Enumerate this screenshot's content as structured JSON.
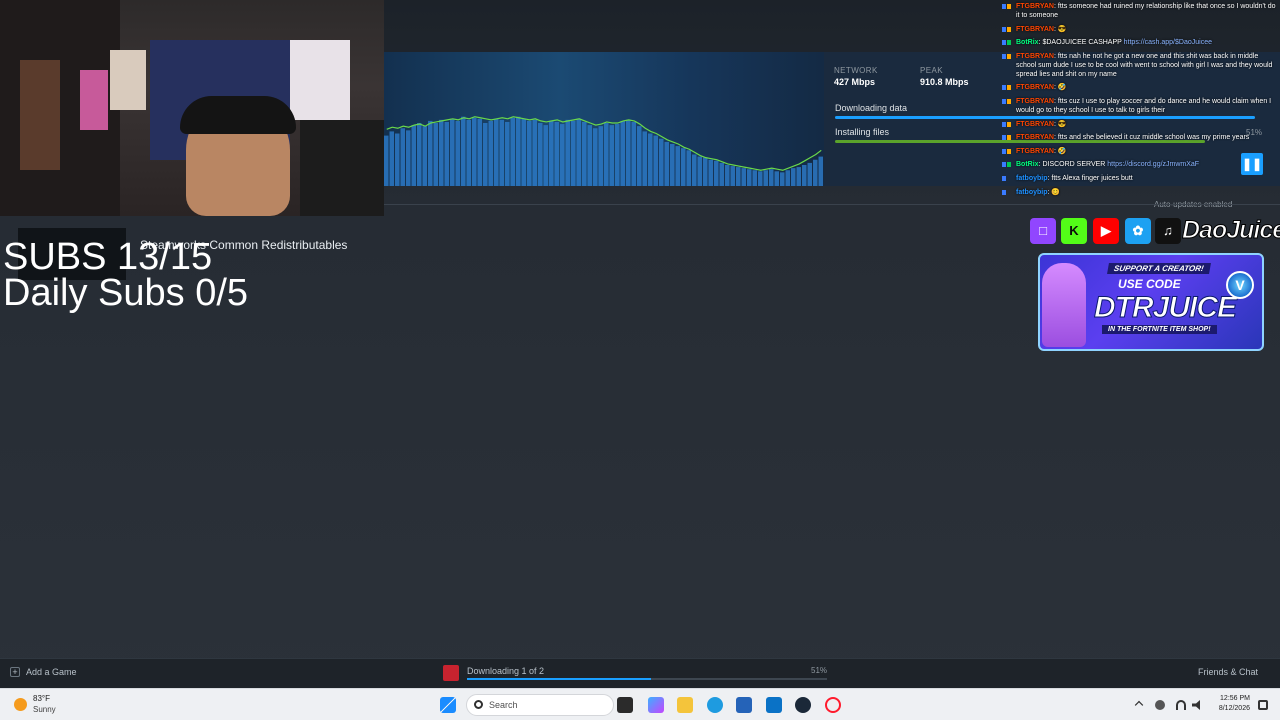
{
  "downloads": {
    "network_label": "NETWORK",
    "network_value": "427 Mbps",
    "peak_label": "PEAK",
    "peak_value": "910.8 Mbps",
    "rows": [
      {
        "label": "Downloading data"
      },
      {
        "label": "Installing files"
      }
    ],
    "percent": "51%",
    "auto_updates": "Auto-updates enabled",
    "queue_item": "Steamworks Common Redistributables"
  },
  "stream_overlay": {
    "subs": "SUBS 13/15",
    "daily": "Daily Subs  0/5",
    "handle": "DaoJuice"
  },
  "chat": [
    {
      "user": "FTGBRYAN",
      "text": ": ftts someone had ruined my relationship like that once so I wouldn't do it to someone",
      "user_color": "#ff4500"
    },
    {
      "user": "FTGBRYAN",
      "text": ": 😎",
      "user_color": "#ff4500"
    },
    {
      "user": "BotRix",
      "text": ": $DAOJUICEE CASHAPP ",
      "link": "https://cash.app/$DaoJuicee",
      "user_color": "#00ff7f"
    },
    {
      "user": "FTGBRYAN",
      "text": ": ftts nah he not he got a new one and this shit was back in middle school sum dude I use to be cool with went to school with girl I was and they would spread lies and shit on my name",
      "user_color": "#ff4500"
    },
    {
      "user": "FTGBRYAN",
      "text": ": 🤣",
      "user_color": "#ff4500"
    },
    {
      "user": "FTGBRYAN",
      "text": ": ftts cuz I use to play soccer and do dance and he would claim when I would go to they school I use to talk to girls their",
      "user_color": "#ff4500"
    },
    {
      "user": "FTGBRYAN",
      "text": ": 😎",
      "user_color": "#ff4500"
    },
    {
      "user": "FTGBRYAN",
      "text": ": ftts and she believed it cuz middle school was my prime years",
      "user_color": "#ff4500"
    },
    {
      "user": "FTGBRYAN",
      "text": ": 🤣",
      "user_color": "#ff4500"
    },
    {
      "user": "BotRix",
      "text": ": DISCORD SERVER ",
      "link": "https://discord.gg/zJmwmXaF",
      "user_color": "#00ff7f"
    },
    {
      "user": "fatboybip",
      "text": ": ftts Alexa finger juices butt",
      "user_color": "#1e90ff"
    },
    {
      "user": "fatboybip",
      "text": ": 😊",
      "user_color": "#1e90ff"
    }
  ],
  "creator_banner": {
    "support": "SUPPORT A CREATOR!",
    "use_code": "USE CODE",
    "code": "DTRJUICE",
    "item_shop": "IN THE FORTNITE ITEM SHOP!",
    "v_badge": "V"
  },
  "steam_footer": {
    "add_game": "Add a Game",
    "downloading": "Downloading 1 of 2",
    "percent": "51%",
    "progress": 0.51,
    "friends_chat": "Friends & Chat"
  },
  "taskbar": {
    "weather_temp": "83°F",
    "weather_desc": "Sunny",
    "search": "Search",
    "time": "12:56 PM",
    "date": "8/12/2026"
  },
  "icons": {
    "pause": "pause-icon",
    "plus": "plus-icon",
    "windows": "windows-start-icon",
    "search": "search-icon"
  },
  "colors": {
    "steam_blue": "#1a9fff",
    "graph_line": "#6ad94a",
    "banner_bg": "#1a2a3e"
  },
  "graph": {
    "bars": [
      48,
      52,
      50,
      55,
      53,
      58,
      60,
      57,
      62,
      60,
      63,
      61,
      64,
      62,
      66,
      63,
      65,
      64,
      60,
      62,
      64,
      63,
      61,
      65,
      66,
      64,
      62,
      63,
      60,
      58,
      62,
      61,
      59,
      63,
      62,
      64,
      61,
      58,
      55,
      57,
      60,
      58,
      59,
      62,
      63,
      61,
      57,
      52,
      50,
      48,
      45,
      42,
      40,
      38,
      36,
      34,
      30,
      28,
      27,
      25,
      24,
      22,
      20,
      19,
      18,
      17,
      16,
      15,
      14,
      15,
      16,
      14,
      13,
      15,
      17,
      18,
      20,
      22,
      25,
      28
    ],
    "line": [
      54,
      56,
      55,
      57,
      56,
      58,
      59,
      57,
      60,
      61,
      62,
      63,
      64,
      63,
      65,
      64,
      66,
      65,
      64,
      63,
      64,
      65,
      64,
      66,
      65,
      64,
      63,
      64,
      62,
      61,
      62,
      63,
      61,
      62,
      63,
      64,
      62,
      60,
      58,
      59,
      61,
      60,
      60,
      62,
      63,
      62,
      59,
      55,
      52,
      50,
      47,
      44,
      42,
      40,
      37,
      35,
      32,
      29,
      27,
      26,
      25,
      23,
      21,
      20,
      19,
      18,
      17,
      16,
      15,
      16,
      17,
      16,
      15,
      17,
      19,
      21,
      24,
      27,
      30,
      34
    ]
  }
}
